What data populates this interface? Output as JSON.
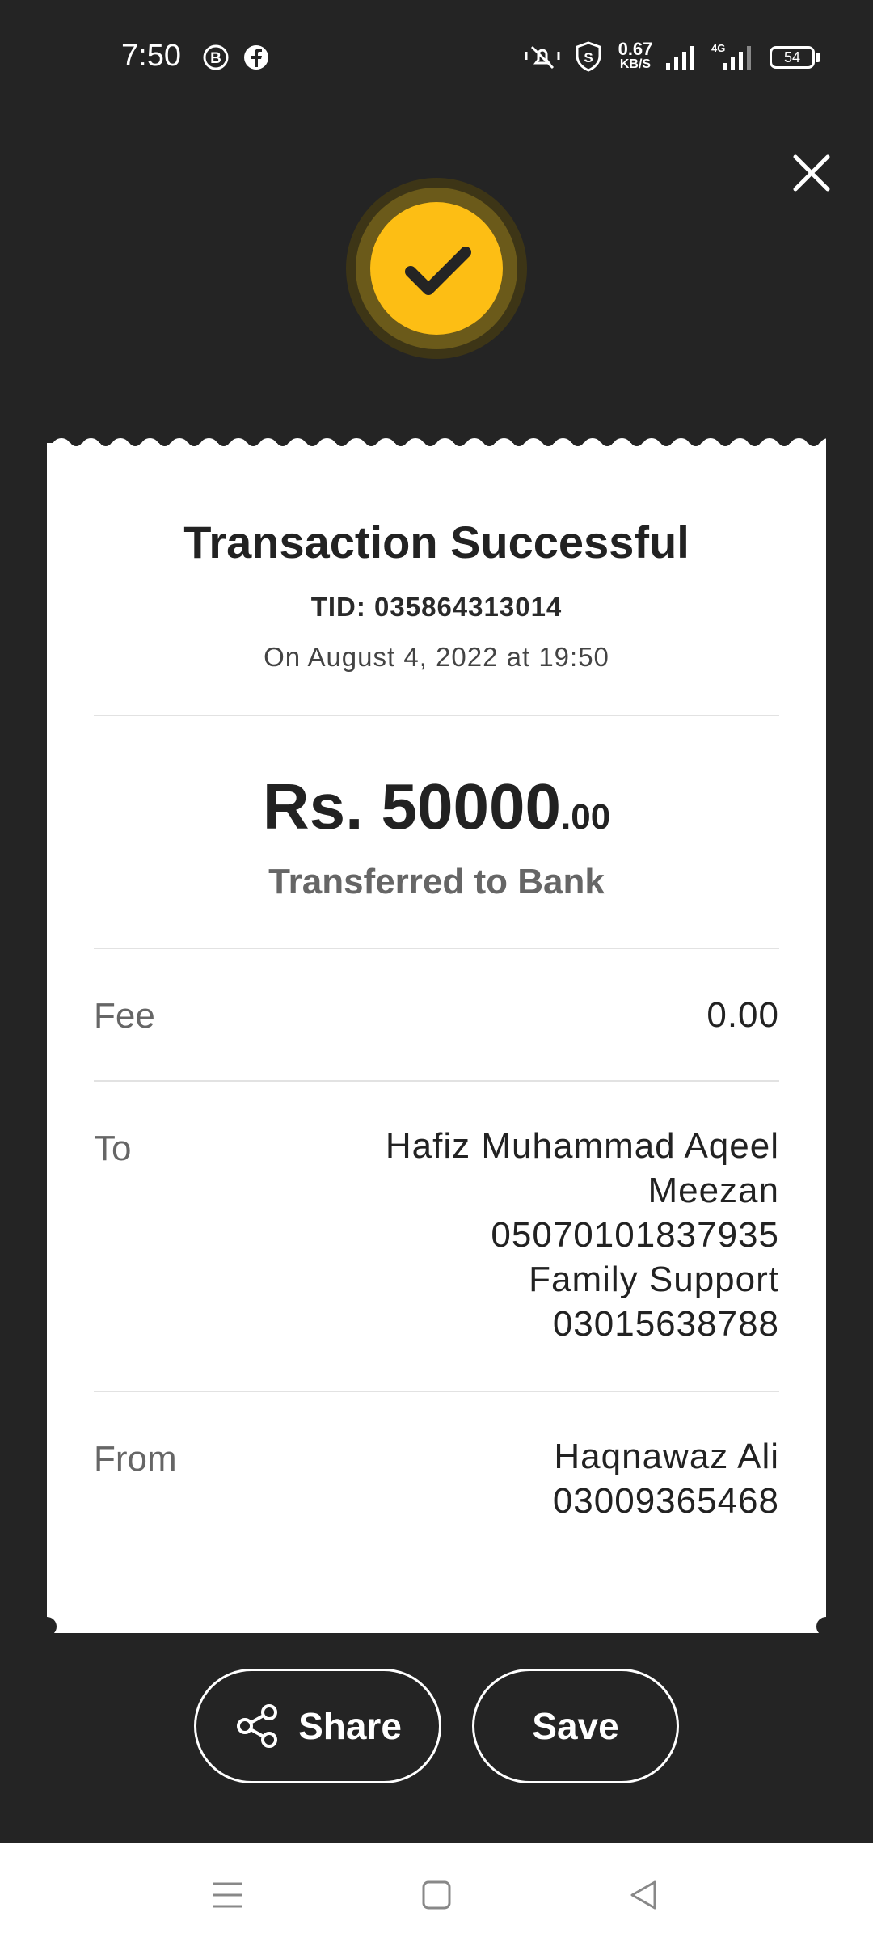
{
  "status_bar": {
    "time": "7:50",
    "net_speed_value": "0.67",
    "net_speed_unit": "KB/S",
    "network_type": "4G",
    "battery": "54",
    "icons": [
      "b-icon",
      "facebook-icon",
      "mute-icon",
      "shield-icon",
      "signal-icon",
      "signal-4g-icon",
      "battery-icon"
    ]
  },
  "receipt": {
    "title": "Transaction Successful",
    "tid": "TID: 035864313014",
    "date": "On August 4, 2022 at 19:50",
    "amount_main": "Rs. 50000",
    "amount_cents": ".00",
    "transfer_type": "Transferred to Bank",
    "fee_label": "Fee",
    "fee_value": "0.00",
    "to_label": "To",
    "to_lines": [
      "Hafiz Muhammad Aqeel",
      "Meezan",
      "05070101837935",
      "Family Support",
      "03015638788"
    ],
    "from_label": "From",
    "from_lines": [
      "Haqnawaz Ali",
      "03009365468"
    ]
  },
  "actions": {
    "share_label": "Share",
    "save_label": "Save"
  },
  "colors": {
    "background": "#242424",
    "accent": "#fdbe14",
    "receipt": "#ffffff"
  }
}
